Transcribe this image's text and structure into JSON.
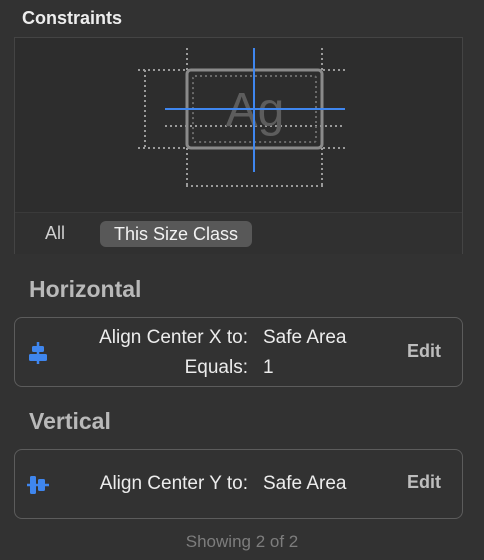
{
  "panel": {
    "title": "Constraints"
  },
  "preview": {
    "glyph": "Ag",
    "tabs": [
      {
        "label": "All",
        "selected": false
      },
      {
        "label": "This Size Class",
        "selected": true
      }
    ]
  },
  "horizontal": {
    "title": "Horizontal",
    "constraint": {
      "icon": "align-center-x-icon",
      "label": "Align Center X to:",
      "target": "Safe Area",
      "equals_label": "Equals:",
      "equals_value": "1",
      "edit_label": "Edit"
    }
  },
  "vertical": {
    "title": "Vertical",
    "constraint": {
      "icon": "align-center-y-icon",
      "label": "Align Center Y to:",
      "target": "Safe Area",
      "edit_label": "Edit"
    }
  },
  "footer": {
    "showing": "Showing 2 of 2"
  },
  "colors": {
    "accent": "#3f86ee",
    "background": "#323232"
  }
}
